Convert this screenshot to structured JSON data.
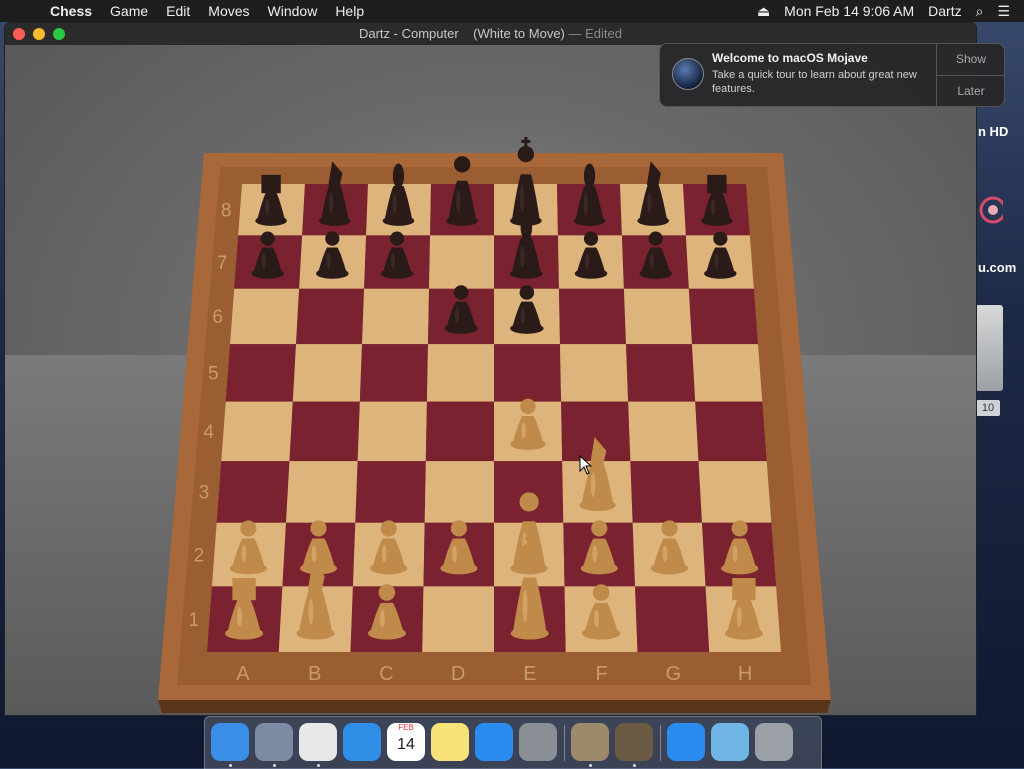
{
  "menubar": {
    "app_name": "Chess",
    "items": [
      "Game",
      "Edit",
      "Moves",
      "Window",
      "Help"
    ],
    "clock": "Mon Feb 14  9:06 AM",
    "user": "Dartz"
  },
  "window": {
    "title": "Dartz - Computer",
    "status": "(White to Move)",
    "edited": "— Edited"
  },
  "notification": {
    "title": "Welcome to macOS Mojave",
    "body": "Take a quick tour to learn about great new features.",
    "show_label": "Show",
    "later_label": "Later"
  },
  "desktop": {
    "label_hd": "n HD",
    "label_com": "u.com",
    "disk_badge": "10"
  },
  "board": {
    "files": [
      "A",
      "B",
      "C",
      "D",
      "E",
      "F",
      "G",
      "H"
    ],
    "ranks": [
      "8",
      "7",
      "6",
      "5",
      "4",
      "3",
      "2",
      "1"
    ],
    "light": "#dcb47c",
    "dark": "#7a2230",
    "white_piece": "#c08a4a",
    "black_piece": "#2a1a18",
    "pieces": [
      {
        "sq": "a8",
        "p": "R",
        "c": "b"
      },
      {
        "sq": "b8",
        "p": "N",
        "c": "b"
      },
      {
        "sq": "c8",
        "p": "B",
        "c": "b"
      },
      {
        "sq": "d8",
        "p": "Q",
        "c": "b"
      },
      {
        "sq": "e8",
        "p": "K",
        "c": "b"
      },
      {
        "sq": "g8",
        "p": "N",
        "c": "b"
      },
      {
        "sq": "h8",
        "p": "R",
        "c": "b"
      },
      {
        "sq": "f8",
        "p": "B",
        "c": "b"
      },
      {
        "sq": "a7",
        "p": "P",
        "c": "b"
      },
      {
        "sq": "b7",
        "p": "P",
        "c": "b"
      },
      {
        "sq": "c7",
        "p": "P",
        "c": "b"
      },
      {
        "sq": "e7",
        "p": "B",
        "c": "b"
      },
      {
        "sq": "f7",
        "p": "P",
        "c": "b"
      },
      {
        "sq": "g7",
        "p": "P",
        "c": "b"
      },
      {
        "sq": "h7",
        "p": "P",
        "c": "b"
      },
      {
        "sq": "d6",
        "p": "P",
        "c": "b"
      },
      {
        "sq": "e6",
        "p": "P",
        "c": "b"
      },
      {
        "sq": "e4",
        "p": "P",
        "c": "w"
      },
      {
        "sq": "f3",
        "p": "N",
        "c": "w"
      },
      {
        "sq": "a2",
        "p": "P",
        "c": "w"
      },
      {
        "sq": "b2",
        "p": "P",
        "c": "w"
      },
      {
        "sq": "c2",
        "p": "P",
        "c": "w"
      },
      {
        "sq": "d2",
        "p": "P",
        "c": "w"
      },
      {
        "sq": "e2",
        "p": "Q",
        "c": "w"
      },
      {
        "sq": "f2",
        "p": "P",
        "c": "w"
      },
      {
        "sq": "g2",
        "p": "P",
        "c": "w"
      },
      {
        "sq": "h2",
        "p": "P",
        "c": "w"
      },
      {
        "sq": "a1",
        "p": "R",
        "c": "w"
      },
      {
        "sq": "b1",
        "p": "N",
        "c": "w"
      },
      {
        "sq": "c1",
        "p": "P",
        "c": "w"
      },
      {
        "sq": "e1",
        "p": "K",
        "c": "w"
      },
      {
        "sq": "f1",
        "p": "P",
        "c": "w"
      },
      {
        "sq": "h1",
        "p": "R",
        "c": "w"
      }
    ]
  },
  "dock": {
    "items": [
      {
        "name": "finder",
        "color": "#3b8ee8"
      },
      {
        "name": "launchpad",
        "color": "#7d8ca3"
      },
      {
        "name": "chrome",
        "color": "#e8e8e8"
      },
      {
        "name": "safari",
        "color": "#2f8fe6"
      },
      {
        "name": "calendar",
        "color": "#ffffff",
        "text": "14",
        "month": "FEB"
      },
      {
        "name": "notes",
        "color": "#f8e27a"
      },
      {
        "name": "app-store",
        "color": "#2a8cf0"
      },
      {
        "name": "system-preferences",
        "color": "#8a8f96"
      },
      {
        "name": "keychain-access",
        "color": "#9c8a6a"
      },
      {
        "name": "chess",
        "color": "#6b5a44"
      },
      {
        "name": "app-store-installer",
        "color": "#2a8cf0"
      },
      {
        "name": "downloads-folder",
        "color": "#6fb6e6"
      },
      {
        "name": "trash",
        "color": "#9aa0a6"
      }
    ]
  }
}
